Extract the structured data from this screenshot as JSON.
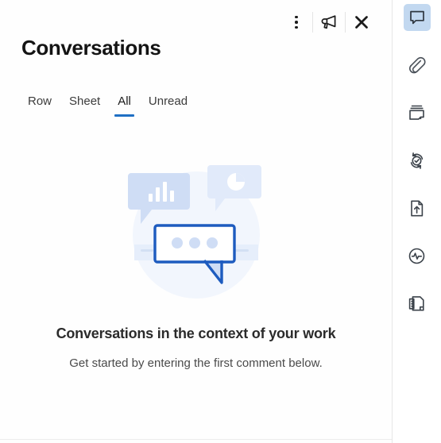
{
  "header": {
    "title": "Conversations",
    "actions": [
      {
        "name": "more-options-button",
        "icon": "more-vertical-icon",
        "label": "More options"
      },
      {
        "name": "announcements-button",
        "icon": "megaphone-icon",
        "label": "Announcements"
      },
      {
        "name": "close-panel-button",
        "icon": "close-icon",
        "label": "Close"
      }
    ]
  },
  "tabs": [
    {
      "label": "Row",
      "active": false
    },
    {
      "label": "Sheet",
      "active": false
    },
    {
      "label": "All",
      "active": true
    },
    {
      "label": "Unread",
      "active": false
    }
  ],
  "empty_state": {
    "illustration": "conversation-bubbles-illustration",
    "heading": "Conversations in the context of your work",
    "subtext": "Get started by entering the first comment below."
  },
  "rail": {
    "items": [
      {
        "name": "rail-item-conversations",
        "icon": "speech-bubble-icon",
        "label": "Conversations",
        "selected": true
      },
      {
        "name": "rail-item-attachments",
        "icon": "paperclip-icon",
        "label": "Attachments",
        "selected": false
      },
      {
        "name": "rail-item-proofs",
        "icon": "proof-stack-icon",
        "label": "Proofs",
        "selected": false
      },
      {
        "name": "rail-item-update-requests",
        "icon": "update-request-icon",
        "label": "Update Requests",
        "selected": false
      },
      {
        "name": "rail-item-publish",
        "icon": "publish-upload-icon",
        "label": "Publish",
        "selected": false
      },
      {
        "name": "rail-item-activity-log",
        "icon": "activity-pulse-icon",
        "label": "Activity Log",
        "selected": false
      },
      {
        "name": "rail-item-summary",
        "icon": "summary-document-icon",
        "label": "Summary",
        "selected": false
      }
    ]
  },
  "colors": {
    "accent_blue": "#1f6fc4",
    "illustration_blue": "#1d5bbf",
    "illustration_light": "#cfddf5",
    "rail_selected_bg": "#c2d8f0",
    "text_primary": "#141414",
    "text_secondary": "#4a4a4a"
  }
}
